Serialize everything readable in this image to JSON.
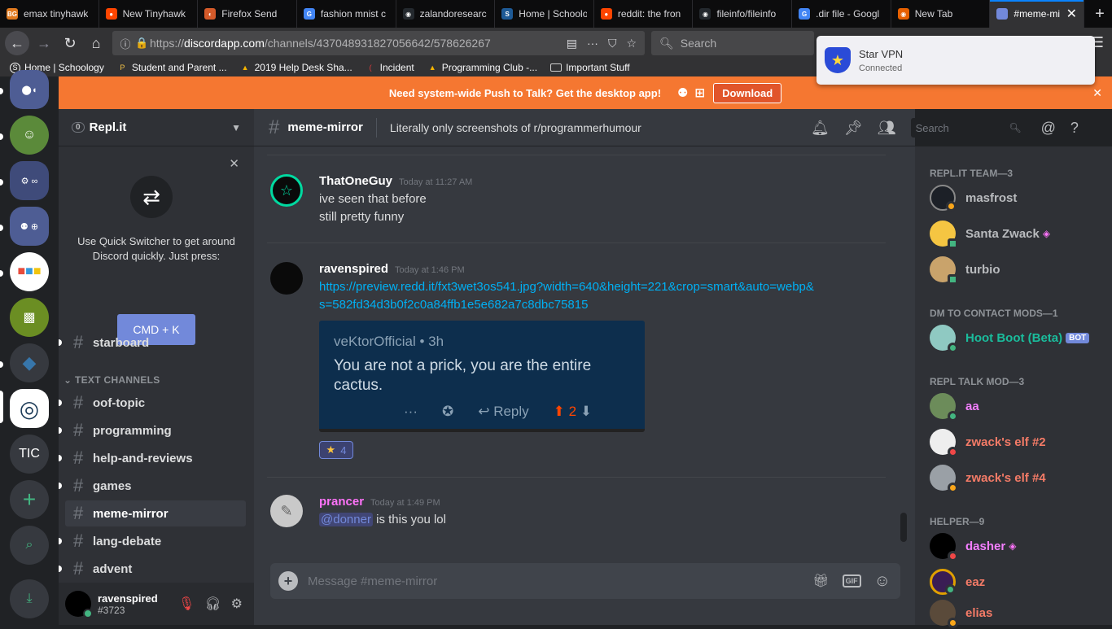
{
  "browser": {
    "tabs": [
      {
        "label": "emax tinyhawk",
        "fav": "BG",
        "color": "#e07a1f"
      },
      {
        "label": "New Tinyhawk",
        "fav": "●",
        "color": "#ff4500"
      },
      {
        "label": "Firefox Send",
        "fav": "◐",
        "color": "#d45a2a"
      },
      {
        "label": "fashion mnist c",
        "fav": "G",
        "color": "#4285f4"
      },
      {
        "label": "zalandoresearc",
        "fav": "◉",
        "color": "#24292e"
      },
      {
        "label": "Home | Schoolo",
        "fav": "S",
        "color": "#1e5a96"
      },
      {
        "label": "reddit: the fron",
        "fav": "●",
        "color": "#ff4500"
      },
      {
        "label": "fileinfo/fileinfo",
        "fav": "◉",
        "color": "#24292e"
      },
      {
        "label": ".dir file - Googl",
        "fav": "G",
        "color": "#4285f4"
      },
      {
        "label": "New Tab",
        "fav": "◉",
        "color": "#e66000"
      }
    ],
    "active_tab": {
      "label": "#meme-mi",
      "close": "✕"
    },
    "new_tab": "+",
    "url": {
      "prefix": "https://",
      "host": "discordapp.com",
      "path": "/channels/437048931827056642/578626267"
    },
    "search_placeholder": "Search",
    "bookmarks": [
      {
        "label": "Home | Schoology",
        "icon": "S",
        "color": "#fff"
      },
      {
        "label": "Student and Parent ...",
        "icon": "P",
        "color": "#f7c648"
      },
      {
        "label": "2019 Help Desk Sha...",
        "icon": "▲",
        "color": "#f4b400"
      },
      {
        "label": "Incident",
        "icon": "(",
        "color": "#e23b3b"
      },
      {
        "label": "Programming Club -...",
        "icon": "▲",
        "color": "#f4b400"
      },
      {
        "label": "Important Stuff",
        "icon": "▭",
        "color": "#cfcfcf"
      }
    ]
  },
  "vpn": {
    "title": "Star VPN",
    "status": "Connected"
  },
  "banner": {
    "text": "Need system-wide Push to Talk? Get the desktop app!",
    "download": "Download",
    "close": "✕"
  },
  "rail": {
    "label_tic": "TIC"
  },
  "guild": {
    "name": "Repl.it",
    "badge": "0"
  },
  "quick_switcher": {
    "text": "Use Quick Switcher to get around Discord quickly. Just press:",
    "button": "CMD + K"
  },
  "channels": {
    "starboard": "starboard",
    "category": "TEXT CHANNELS",
    "list": [
      "oof-topic",
      "programming",
      "help-and-reviews",
      "games",
      "meme-mirror",
      "lang-debate",
      "advent"
    ]
  },
  "user": {
    "name": "ravenspired",
    "tag": "#3723"
  },
  "chat": {
    "channel": "meme-mirror",
    "topic": "Literally only screenshots of r/programmerhumour",
    "search_placeholder": "Search",
    "composer_placeholder": "Message #meme-mirror",
    "gif_label": "GIF",
    "messages": [
      {
        "author": "ThatOneGuy",
        "timestamp": "Today at 11:27 AM",
        "lines": [
          "ive seen that before",
          "still pretty funny"
        ],
        "color": "#ffffff"
      },
      {
        "author": "ravenspired",
        "timestamp": "Today at 1:46 PM",
        "link1": "https://preview.redd.it/fxt3wet3os541.jpg?width=640&height=221&crop=smart&auto=webp&",
        "link2": "s=582fd34d3b0f2c0a84ffb1e5e682a7c8dbc75815",
        "color": "#ffffff"
      },
      {
        "author": "prancer",
        "timestamp": "Today at 1:49 PM",
        "mention": "@donner",
        "text": " is this you lol",
        "color": "#ff73fa"
      }
    ],
    "embed": {
      "user": "veKtorOfficial • 3h",
      "body": "You are not a prick, you are the entire cactus.",
      "dots": "···",
      "reply": "Reply",
      "score": "2"
    },
    "reaction": {
      "emoji": "★",
      "count": "4"
    }
  },
  "members": {
    "groups": [
      {
        "title": "REPL.IT TEAM—3",
        "members": [
          {
            "name": "masfrost",
            "color": "#b9bbbe"
          },
          {
            "name": "Santa Zwack",
            "color": "#b9bbbe"
          },
          {
            "name": "turbio",
            "color": "#b9bbbe"
          }
        ]
      },
      {
        "title": "DM TO CONTACT MODS—1",
        "members": [
          {
            "name": "Hoot Boot (Beta)",
            "color": "#1abc9c",
            "bot": "BOT"
          }
        ]
      },
      {
        "title": "REPL TALK MOD—3",
        "members": [
          {
            "name": "aa",
            "color": "#f47fff"
          },
          {
            "name": "zwack's elf #2",
            "color": "#f47b67"
          },
          {
            "name": "zwack's elf #4",
            "color": "#f47b67"
          }
        ]
      },
      {
        "title": "HELPER—9",
        "members": [
          {
            "name": "dasher",
            "color": "#f47fff"
          },
          {
            "name": "eaz",
            "color": "#f47b67"
          },
          {
            "name": "elias",
            "color": "#f47b67"
          }
        ]
      }
    ]
  }
}
